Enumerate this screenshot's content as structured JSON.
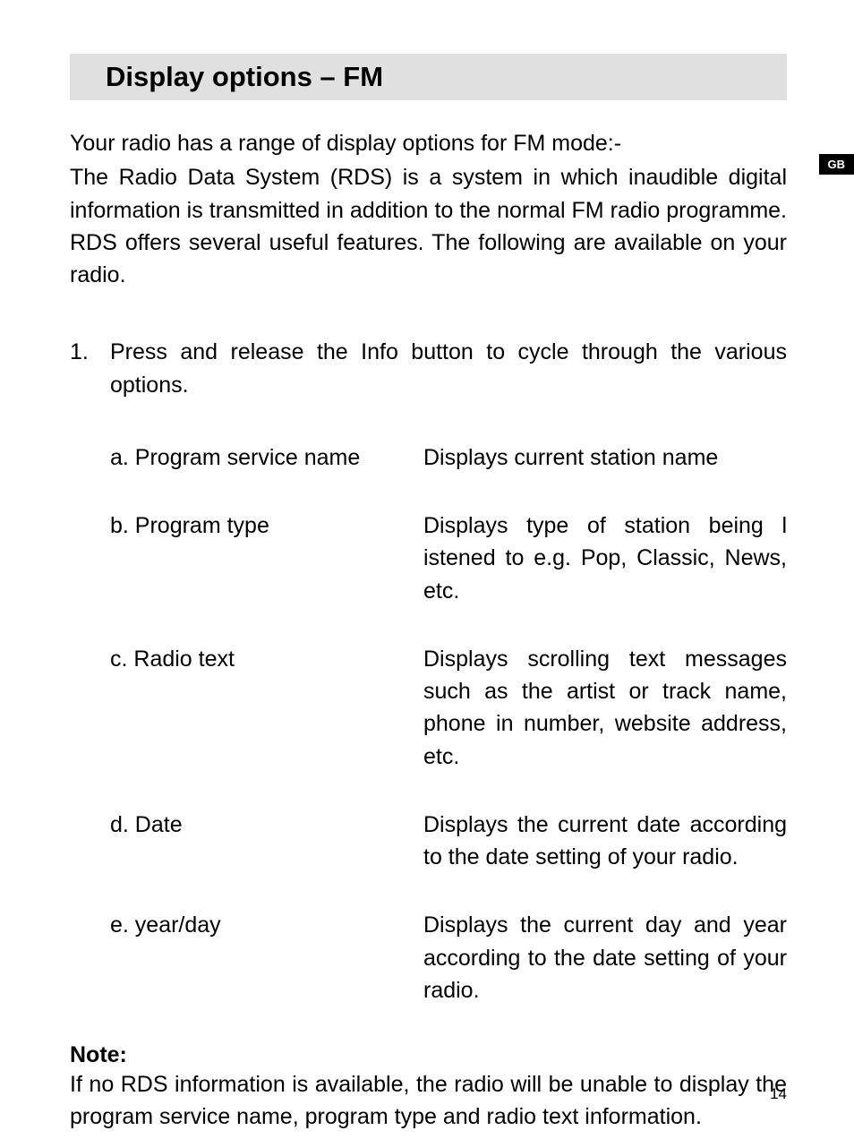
{
  "heading": "Display options – FM",
  "languageTab": "GB",
  "introLine": "Your radio has a range of display options for FM mode:-",
  "introPara": "The Radio Data System (RDS) is a system in which inaudible digital information is transmitted in addition to the normal FM radio programme. RDS offers several useful features. The following are available on your radio.",
  "step": {
    "num": "1.",
    "text": "Press and release the Info button to cycle through the various options."
  },
  "options": [
    {
      "label": "a. Program service name",
      "desc": "Displays current station name"
    },
    {
      "label": "b. Program type",
      "desc": "Displays type of station being l istened to e.g. Pop, Classic, News, etc."
    },
    {
      "label": "c. Radio text",
      "desc": "Displays scrolling text messages such as the artist or track name, phone in number, website address, etc."
    },
    {
      "label": "d. Date",
      "desc": "Displays the current date according to the date setting of your radio."
    },
    {
      "label": "e. year/day",
      "desc": "Displays the current day and year according to the date setting of your radio."
    }
  ],
  "noteLabel": "Note:",
  "noteText": "If no RDS information is available, the radio will be unable to display the program service name, program type and radio text information.",
  "pageNumber": "14"
}
